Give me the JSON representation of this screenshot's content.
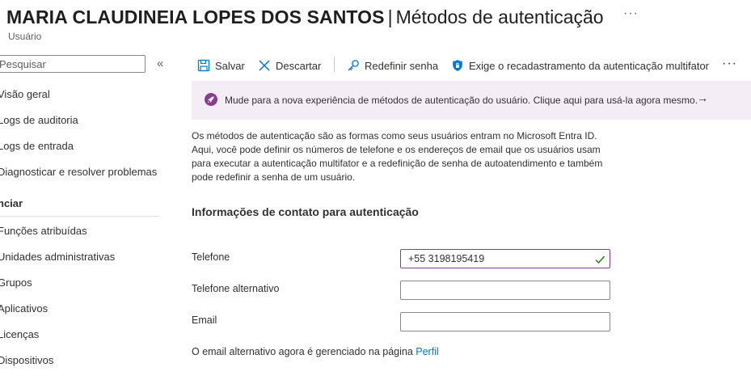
{
  "header": {
    "user_name": "MARIA CLAUDINEIA LOPES DOS SANTOS",
    "separator": "|",
    "page_name": "Métodos de autenticação",
    "subtitle": "Usuário",
    "more_label": "···"
  },
  "sidebar": {
    "search_placeholder": "Pesquisar",
    "collapse_label": "«",
    "items": [
      {
        "label": "Visão geral"
      },
      {
        "label": "Logs de auditoria"
      },
      {
        "label": "Logs de entrada"
      },
      {
        "label": "Diagnosticar e resolver problemas"
      }
    ],
    "section_label": "nciar",
    "manage_items": [
      {
        "label": "Funções atribuídas"
      },
      {
        "label": "Unidades administrativas"
      },
      {
        "label": "Grupos"
      },
      {
        "label": "Aplicativos"
      },
      {
        "label": "Licenças"
      },
      {
        "label": "Dispositivos"
      }
    ]
  },
  "toolbar": {
    "save_label": "Salvar",
    "discard_label": "Descartar",
    "reset_password_label": "Redefinir senha",
    "require_mfa_label": "Exige o recadastramento da autenticação multifator",
    "more_label": "···"
  },
  "banner": {
    "text": "Mude para a nova experiência de métodos de autenticação do usuário. Clique aqui para usá-la agora mesmo.",
    "arrow": "→",
    "icon": "rocket-icon"
  },
  "main": {
    "description": "Os métodos de autenticação são as formas como seus usuários entram no Microsoft Entra ID. Aqui, você pode definir os números de telefone e os endereços de email que os usuários usam para executar a autenticação multifator e a redefinição de senha de autoatendimento e também pode redefinir a senha de um usuário.",
    "section_title": "Informações de contato para autenticação",
    "fields": {
      "phone_label": "Telefone",
      "phone_value": "+55 3198195419",
      "alt_phone_label": "Telefone alternativo",
      "alt_phone_value": "",
      "email_label": "Email",
      "email_value": ""
    },
    "footnote_text": "O email alternativo agora é gerenciado na página ",
    "footnote_link": "Perfil"
  },
  "colors": {
    "accent": "#0078d4",
    "banner_bg": "#f4edf6",
    "focus_border": "#8a3c8f",
    "check_green": "#107c10"
  }
}
